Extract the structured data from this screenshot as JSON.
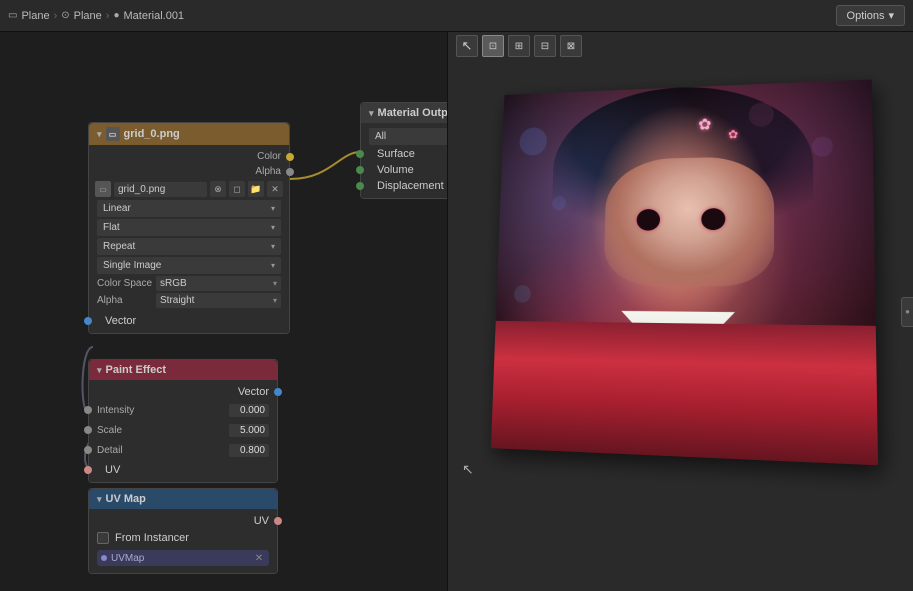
{
  "topbar": {
    "breadcrumb": [
      {
        "icon": "plane-icon",
        "label": "Plane"
      },
      {
        "icon": "plane-icon",
        "label": "Plane"
      },
      {
        "icon": "material-icon",
        "label": "Material.001"
      }
    ],
    "options_label": "Options",
    "options_arrow": "▾"
  },
  "viewport": {
    "tools": [
      "cursor",
      "frame-all",
      "frame-selected",
      "zoom-extents",
      "pan"
    ]
  },
  "nodes": {
    "texture": {
      "title": "grid_0.png",
      "filename": "grid_0.png",
      "outputs": [
        {
          "label": "Color",
          "socket": "yellow"
        },
        {
          "label": "Alpha",
          "socket": "gray"
        }
      ],
      "dropdowns": [
        {
          "value": "Linear"
        },
        {
          "value": "Flat"
        },
        {
          "value": "Repeat"
        },
        {
          "value": "Single Image"
        }
      ],
      "color_space_label": "Color Space",
      "color_space_value": "sRGB",
      "alpha_label": "Alpha",
      "alpha_value": "Straight",
      "vector_label": "Vector"
    },
    "material_output": {
      "title": "Material Output",
      "filter_label": "All",
      "inputs": [
        {
          "label": "Surface",
          "socket": "green"
        },
        {
          "label": "Volume",
          "socket": "green"
        },
        {
          "label": "Displacement",
          "socket": "green"
        }
      ]
    },
    "paint_effect": {
      "title": "Paint Effect",
      "vector_label": "Vector",
      "fields": [
        {
          "label": "Intensity",
          "value": "0.000"
        },
        {
          "label": "Scale",
          "value": "5.000"
        },
        {
          "label": "Detail",
          "value": "0.800"
        }
      ],
      "output_label": "UV"
    },
    "uv_map": {
      "title": "UV Map",
      "output_label": "UV",
      "from_instancer_label": "From Instancer",
      "uvmap_name": "UVMap"
    }
  }
}
